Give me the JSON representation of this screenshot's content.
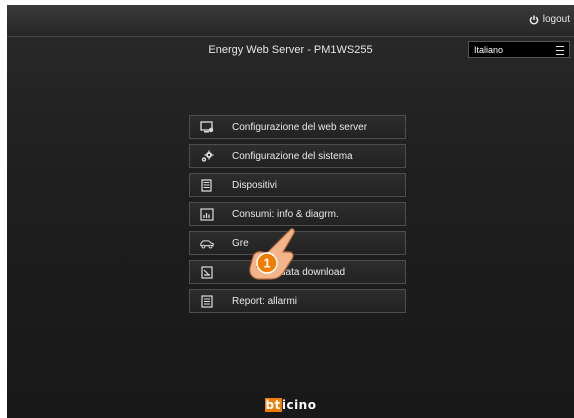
{
  "header": {
    "logout_label": "logout"
  },
  "title": "Energy Web Server - PM1WS255",
  "language": {
    "selected": "Italiano"
  },
  "menu": {
    "items": [
      {
        "label": "Configurazione del web server",
        "icon": "monitor-config-icon"
      },
      {
        "label": "Configurazione del sistema",
        "icon": "gears-icon"
      },
      {
        "label": "Dispositivi",
        "icon": "devices-icon"
      },
      {
        "label": "Consumi: info & diagrm.",
        "icon": "chart-icon"
      },
      {
        "label": "Gre",
        "icon": "car-icon"
      },
      {
        "label": "data download",
        "icon": "download-icon"
      },
      {
        "label": "Report: allarmi",
        "icon": "report-icon"
      }
    ]
  },
  "callout": {
    "number": "1"
  },
  "footer": {
    "brand_highlight": "bt",
    "brand_rest": "icino"
  },
  "colors": {
    "accent": "#f07d00",
    "background": "#1f1f1f"
  }
}
